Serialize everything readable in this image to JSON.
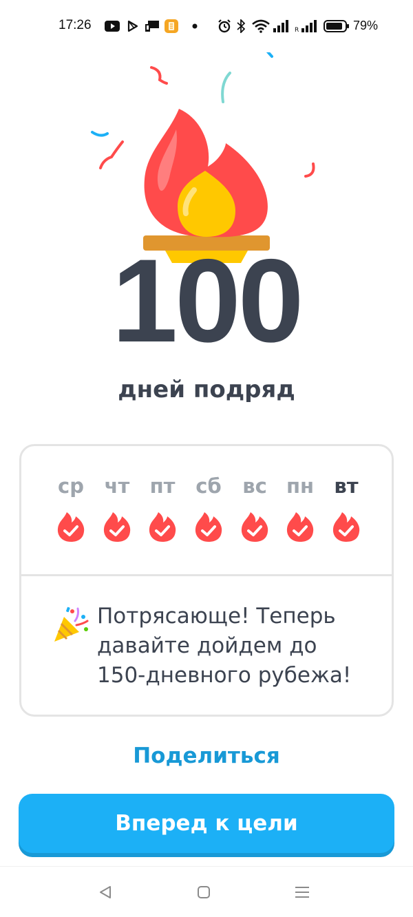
{
  "status_bar": {
    "time": "17:26",
    "battery_percent": "79%",
    "icons": [
      "youtube-icon",
      "play-store-icon",
      "cast-icon",
      "app-icon",
      "dot-icon",
      "alarm-icon",
      "bluetooth-icon",
      "wifi-icon",
      "signal-icon",
      "signal-icon-2",
      "battery-icon"
    ]
  },
  "hero": {
    "streak_number": "100",
    "streak_label": "дней подряд",
    "icons": [
      "flame-icon",
      "confetti"
    ]
  },
  "week": {
    "days": [
      {
        "label": "ср",
        "completed": true,
        "current": false
      },
      {
        "label": "чт",
        "completed": true,
        "current": false
      },
      {
        "label": "пт",
        "completed": true,
        "current": false
      },
      {
        "label": "сб",
        "completed": true,
        "current": false
      },
      {
        "label": "вс",
        "completed": true,
        "current": false
      },
      {
        "label": "пн",
        "completed": true,
        "current": false
      },
      {
        "label": "вт",
        "completed": true,
        "current": true
      }
    ]
  },
  "message": {
    "line1": "Потрясающе! Теперь",
    "line2": "давайте дойдем до",
    "line3": "150-дневного рубежа!",
    "icon": "party-popper-icon"
  },
  "actions": {
    "share_label": "Поделиться",
    "continue_label": "Вперед к цели"
  },
  "nav": {
    "icons": [
      "back-icon",
      "home-icon",
      "menu-icon"
    ]
  },
  "colors": {
    "flame_red": "#ff4b4b",
    "flame_yellow": "#ffc800",
    "text_dark": "#3c4350",
    "text_muted": "#9ea5ad",
    "primary_blue": "#1cb0f6",
    "link_blue": "#1899d6"
  }
}
